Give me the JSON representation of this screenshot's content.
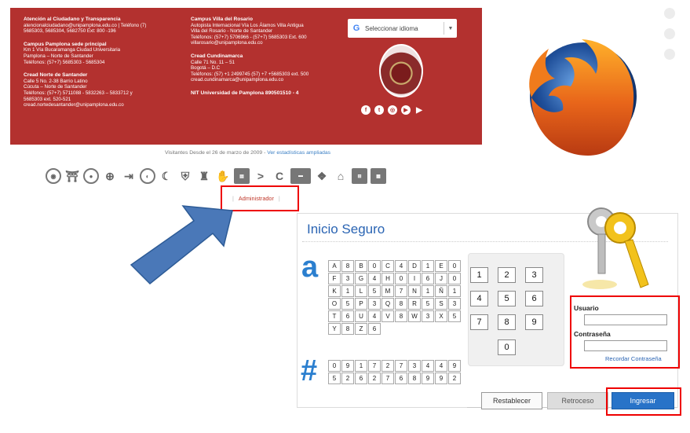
{
  "footer": {
    "col1": {
      "attention_title": "Atención al Ciudadano y Transparencia",
      "attention_line1": "atencionalciudadano@unipamplona.edu.co | Teléfono (7)",
      "attention_line2": "5685303, 5685304, 5682750 Ext: 800 -196",
      "pamplona_title": "Campus Pamplona sede principal",
      "pamplona_line1": "Km 1 Vía Bucaramanga Ciudad Universitaria",
      "pamplona_line2": "Pamplona – Norte de Santander",
      "pamplona_line3": "Teléfonos: (57+7) 5685303 - 5685304",
      "nds_title": "Cread Norte de Santander",
      "nds_line1": "Calle 5 No. 2-38 Barrio Latino",
      "nds_line2": "Cúcuta – Norte de Santander",
      "nds_line3": "Teléfonos: (57+7) 5711088 - 5832263 – 5833712 y",
      "nds_line4": "5685303 ext. 520-521",
      "nds_line5": "cread.nortedesantander@unipamplona.edu.co"
    },
    "col2": {
      "rosario_title": "Campus Villa del Rosario",
      "rosario_line1": "Autopista Internacional Vía Los Álamos  Villa Antigua",
      "rosario_line2": "Villa del Rosario - Norte de Santander",
      "rosario_line3": "Teléfonos: (57+7) 5706966 - (57+7) 5685303 Ext. 600",
      "rosario_line4": "villarosario@unipamplona.edu.co",
      "cund_title": "Cread Cundinamarca",
      "cund_line1": "Calle 71 No. 11 – 51",
      "cund_line2": "Bogotá – D.C",
      "cund_line3": "Teléfonos: (57) +1 2499745 (57) +7 +5685303 ext. 500",
      "cund_line4": "cread.cundinamarca@unipamplona.edu.co",
      "nit": "NIT Universidad de Pamplona 890501510 - 4"
    },
    "language_selector": "Seleccionar idioma",
    "social_icons": [
      "facebook-icon",
      "twitter-icon",
      "instagram-icon",
      "youtube-icon",
      "soundcloud-icon"
    ]
  },
  "visitors": {
    "text": "Visitantes Desde el 26 de marzo de 2009 -",
    "link": "Ver estadísticas ampliadas"
  },
  "admin_link": "Administrador",
  "login": {
    "title": "Inicio Seguro",
    "letters_icon": "a",
    "numbers_icon": "#",
    "keys": [
      "A",
      "8",
      "B",
      "0",
      "C",
      "4",
      "D",
      "1",
      "E",
      "0",
      "F",
      "3",
      "G",
      "4",
      "H",
      "0",
      "I",
      "6",
      "J",
      "0",
      "K",
      "1",
      "L",
      "5",
      "M",
      "7",
      "N",
      "1",
      "Ñ",
      "1",
      "O",
      "5",
      "P",
      "3",
      "Q",
      "8",
      "R",
      "5",
      "S",
      "3",
      "T",
      "6",
      "U",
      "4",
      "V",
      "8",
      "W",
      "3",
      "X",
      "5",
      "Y",
      "8",
      "Z",
      "6"
    ],
    "number_rows": [
      "0",
      "9",
      "1",
      "7",
      "2",
      "7",
      "3",
      "4",
      "4",
      "9",
      "5",
      "2",
      "6",
      "2",
      "7",
      "6",
      "8",
      "9",
      "9",
      "2"
    ],
    "numpad": [
      "1",
      "2",
      "3",
      "4",
      "5",
      "6",
      "7",
      "8",
      "9",
      "0"
    ],
    "user_label": "Usuario",
    "password_label": "Contraseña",
    "forgot": "Recordar Contraseña",
    "reset_button": "Restablecer",
    "back_button": "Retroceso",
    "submit_button": "Ingresar"
  },
  "colors": {
    "footer_bg": "#b3312f",
    "accent_blue": "#2a64b3",
    "button_blue": "#2873c8",
    "highlight_red": "#ee0000"
  }
}
